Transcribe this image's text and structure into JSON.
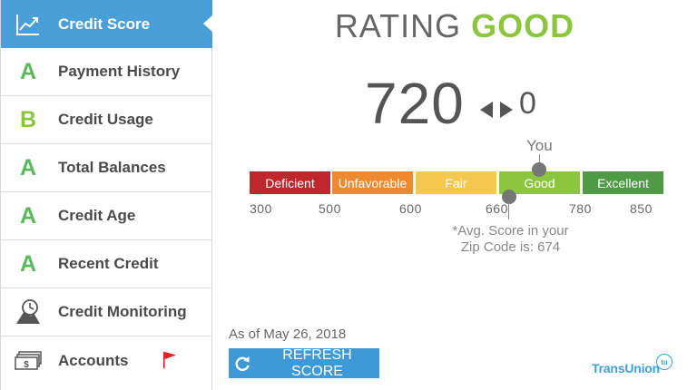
{
  "sidebar": {
    "items": [
      {
        "label": "Credit Score",
        "icon": "trend-chart-icon",
        "active": true
      },
      {
        "label": "Payment History",
        "grade": "A",
        "grade_color": "#5cb85c"
      },
      {
        "label": "Credit Usage",
        "grade": "B",
        "grade_color": "#8cc63f"
      },
      {
        "label": "Total Balances",
        "grade": "A",
        "grade_color": "#5cb85c"
      },
      {
        "label": "Credit Age",
        "grade": "A",
        "grade_color": "#5cb85c"
      },
      {
        "label": "Recent Credit",
        "grade": "A",
        "grade_color": "#5cb85c"
      },
      {
        "label": "Credit Monitoring",
        "icon": "monitoring-clock-icon"
      },
      {
        "label": "Accounts",
        "icon": "money-stack-icon",
        "flag": true
      }
    ]
  },
  "rating": {
    "word": "RATING",
    "value": "GOOD",
    "value_color": "#8cc63f"
  },
  "score": {
    "value": "720",
    "change": "0"
  },
  "scale": {
    "you_label": "You",
    "bands": [
      {
        "label": "Deficient",
        "color": "#c0272d"
      },
      {
        "label": "Unfavorable",
        "color": "#ee8a32"
      },
      {
        "label": "Fair",
        "color": "#f5c94f"
      },
      {
        "label": "Good",
        "color": "#8cc63f"
      },
      {
        "label": "Excellent",
        "color": "#4e9a45"
      }
    ],
    "ticks": [
      "300",
      "500",
      "600",
      "660",
      "780",
      "850"
    ],
    "avg_note_line1": "*Avg. Score in your",
    "avg_note_line2": "Zip Code is: 674"
  },
  "footer": {
    "as_of": "As of May 26, 2018",
    "refresh_label": "REFRESH SCORE",
    "brand": "TransUnion",
    "brand_badge": "tu"
  },
  "colors": {
    "accent": "#4a9fd8",
    "flag": "#e02020"
  }
}
